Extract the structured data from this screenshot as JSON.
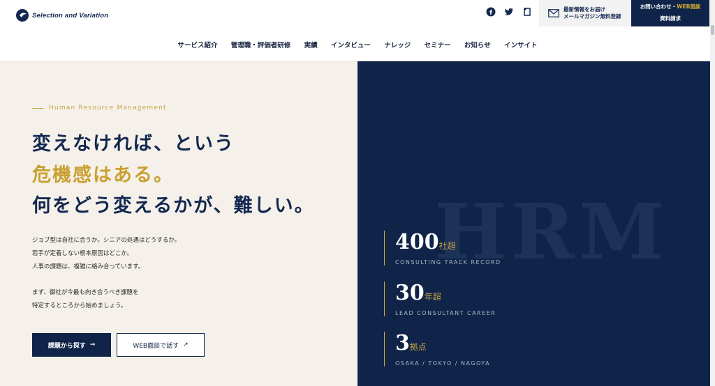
{
  "brand": {
    "name": "Selection and Variation"
  },
  "header": {
    "social_icons": [
      "facebook-icon",
      "twitter-icon",
      "note-icon"
    ],
    "newsletter": {
      "line1": "最新情報をお届け",
      "line2": "メールマガジン無料登録"
    },
    "contact": {
      "line1_prefix": "お問い合わせ・",
      "line1_highlight": "WEB面談",
      "line2": "資料請求"
    },
    "nav": [
      "サービス紹介",
      "管理職・評価者研修",
      "実績",
      "インタビュー",
      "ナレッジ",
      "セミナー",
      "お知らせ",
      "インサイト"
    ]
  },
  "hero": {
    "eyebrow": "Human Resource Management",
    "headline": [
      "変えなければ、という",
      "危機感はある。",
      "何をどう変えるかが、難しい。"
    ],
    "body1": [
      "ジョブ型は自社に合うか。シニアの処遇はどうするか。",
      "若手が定着しない根本原因はどこか。",
      "人事の課題は、複雑に絡み合っています。"
    ],
    "body2": [
      "まず、御社が今最も向き合うべき課題を",
      "特定するところから始めましょう。"
    ],
    "primary_button": {
      "label": "課題から探す",
      "icon": "→"
    },
    "secondary_button": {
      "label": "WEB面談で話す",
      "icon": "↗"
    }
  },
  "stats_panel": {
    "watermark": "HRM",
    "stats": [
      {
        "value": "400",
        "unit": "社超",
        "caption": "CONSULTING TRACK RECORD"
      },
      {
        "value": "30",
        "unit": "年超",
        "caption": "LEAD CONSULTANT CAREER"
      },
      {
        "value": "3",
        "unit": "拠点",
        "caption": "OSAKA / TOKYO / NAGOYA"
      }
    ]
  },
  "colors": {
    "navy": "#0f2448",
    "gold": "#c9a444",
    "cream": "#f5f1ea"
  }
}
